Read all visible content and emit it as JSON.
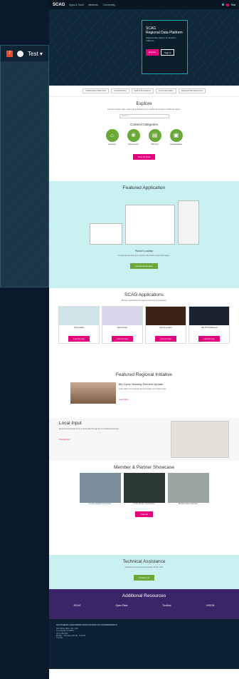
{
  "inset": {
    "badge": "7",
    "user": "Test ▾"
  },
  "header": {
    "logo": "SCAG",
    "nav": [
      "Apps & Tools",
      "Initiatives",
      "Community"
    ],
    "user": "Test"
  },
  "hero": {
    "title": "SCAG\nRegional Data Platform",
    "subtitle": "Regional data platform for Southern California",
    "btn_primary": "Explore",
    "btn_secondary": "Sign in"
  },
  "tabs": [
    "Collaborative Work Area",
    "Local Planning",
    "Data & Applications",
    "Local Information",
    "Regional Plan Resources"
  ],
  "explore": {
    "title": "Explore",
    "desc": "Find and explore data, maps and applications from across the Southern California region.",
    "search_placeholder": "Search..."
  },
  "categories": {
    "title": "Content Categories",
    "items": [
      {
        "label": "Land Use",
        "icon": "land-use-icon"
      },
      {
        "label": "Environment",
        "icon": "environment-icon"
      },
      {
        "label": "Planning",
        "icon": "planning-icon"
      },
      {
        "label": "Transportation",
        "icon": "transportation-icon"
      }
    ],
    "button": "View All Data"
  },
  "featured_app": {
    "title": "Featured Application",
    "app_name": "Parcel Locator",
    "desc": "Locate parcels and view property information across the region.",
    "button": "Launch Application"
  },
  "apps": {
    "title": "SCAG Applications",
    "desc": "Browse applications for regional planning and analysis.",
    "items": [
      {
        "title": "SoCal Atlas",
        "button": "Launch App"
      },
      {
        "title": "Data Viewer",
        "button": "Launch App"
      },
      {
        "title": "Parcel Locator",
        "button": "Launch App"
      },
      {
        "title": "HELPR Dashboard",
        "button": "Launch App"
      }
    ]
  },
  "initiative": {
    "title": "Featured Regional Initiative",
    "headline": "6th Cycle Housing Element Update",
    "desc": "Learn about the housing element update and related tools.",
    "link": "Learn More"
  },
  "local_input": {
    "title": "Local Input",
    "desc": "Review and provide input on local data through the Local Data Exchange.",
    "link": "Provide Input"
  },
  "showcase": {
    "title": "Member & Partner Showcase",
    "items": [
      {
        "title": "Ontario Heights City Center"
      },
      {
        "title": "Public Works Coordination"
      },
      {
        "title": "Mobility Data Collection"
      }
    ],
    "button": "View All"
  },
  "assistance": {
    "title": "Technical Assistance",
    "desc": "Request technical assistance from SCAG staff.",
    "button": "Contact Us"
  },
  "resources": {
    "title": "Additional Resources",
    "items": [
      "SCAG",
      "Open Data",
      "Toolbox",
      "VISION"
    ]
  },
  "footer": {
    "org": "SOUTHERN CALIFORNIA ASSOCIATION OF GOVERNMENTS",
    "address": "900 Wilshire Blvd., Ste. 1700\nLos Angeles, CA 90017\n(213) 236-1800",
    "hours": "Monday - Thursday 8:00 AM - 5:00 PM",
    "copyright": "© SCAG"
  },
  "colors": {
    "pink": "#e5007d",
    "green": "#6aa838",
    "teal": "#c9f1f2",
    "purple": "#3c2469"
  }
}
